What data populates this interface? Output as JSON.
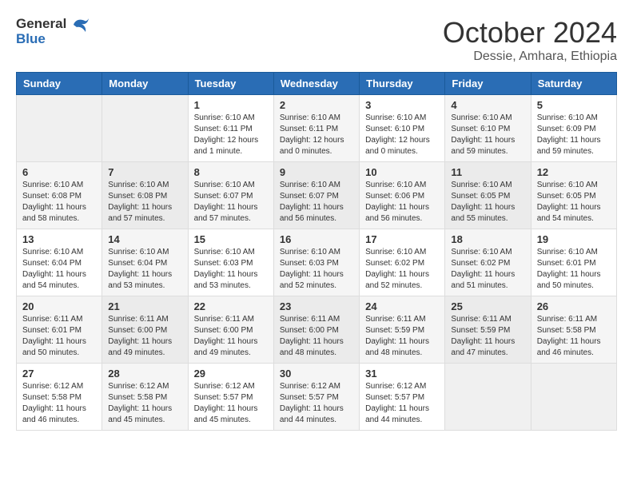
{
  "header": {
    "logo_line1": "General",
    "logo_line2": "Blue",
    "month": "October 2024",
    "location": "Dessie, Amhara, Ethiopia"
  },
  "weekdays": [
    "Sunday",
    "Monday",
    "Tuesday",
    "Wednesday",
    "Thursday",
    "Friday",
    "Saturday"
  ],
  "weeks": [
    [
      {
        "day": "",
        "info": ""
      },
      {
        "day": "",
        "info": ""
      },
      {
        "day": "1",
        "info": "Sunrise: 6:10 AM\nSunset: 6:11 PM\nDaylight: 12 hours\nand 1 minute."
      },
      {
        "day": "2",
        "info": "Sunrise: 6:10 AM\nSunset: 6:11 PM\nDaylight: 12 hours\nand 0 minutes."
      },
      {
        "day": "3",
        "info": "Sunrise: 6:10 AM\nSunset: 6:10 PM\nDaylight: 12 hours\nand 0 minutes."
      },
      {
        "day": "4",
        "info": "Sunrise: 6:10 AM\nSunset: 6:10 PM\nDaylight: 11 hours\nand 59 minutes."
      },
      {
        "day": "5",
        "info": "Sunrise: 6:10 AM\nSunset: 6:09 PM\nDaylight: 11 hours\nand 59 minutes."
      }
    ],
    [
      {
        "day": "6",
        "info": "Sunrise: 6:10 AM\nSunset: 6:08 PM\nDaylight: 11 hours\nand 58 minutes."
      },
      {
        "day": "7",
        "info": "Sunrise: 6:10 AM\nSunset: 6:08 PM\nDaylight: 11 hours\nand 57 minutes."
      },
      {
        "day": "8",
        "info": "Sunrise: 6:10 AM\nSunset: 6:07 PM\nDaylight: 11 hours\nand 57 minutes."
      },
      {
        "day": "9",
        "info": "Sunrise: 6:10 AM\nSunset: 6:07 PM\nDaylight: 11 hours\nand 56 minutes."
      },
      {
        "day": "10",
        "info": "Sunrise: 6:10 AM\nSunset: 6:06 PM\nDaylight: 11 hours\nand 56 minutes."
      },
      {
        "day": "11",
        "info": "Sunrise: 6:10 AM\nSunset: 6:05 PM\nDaylight: 11 hours\nand 55 minutes."
      },
      {
        "day": "12",
        "info": "Sunrise: 6:10 AM\nSunset: 6:05 PM\nDaylight: 11 hours\nand 54 minutes."
      }
    ],
    [
      {
        "day": "13",
        "info": "Sunrise: 6:10 AM\nSunset: 6:04 PM\nDaylight: 11 hours\nand 54 minutes."
      },
      {
        "day": "14",
        "info": "Sunrise: 6:10 AM\nSunset: 6:04 PM\nDaylight: 11 hours\nand 53 minutes."
      },
      {
        "day": "15",
        "info": "Sunrise: 6:10 AM\nSunset: 6:03 PM\nDaylight: 11 hours\nand 53 minutes."
      },
      {
        "day": "16",
        "info": "Sunrise: 6:10 AM\nSunset: 6:03 PM\nDaylight: 11 hours\nand 52 minutes."
      },
      {
        "day": "17",
        "info": "Sunrise: 6:10 AM\nSunset: 6:02 PM\nDaylight: 11 hours\nand 52 minutes."
      },
      {
        "day": "18",
        "info": "Sunrise: 6:10 AM\nSunset: 6:02 PM\nDaylight: 11 hours\nand 51 minutes."
      },
      {
        "day": "19",
        "info": "Sunrise: 6:10 AM\nSunset: 6:01 PM\nDaylight: 11 hours\nand 50 minutes."
      }
    ],
    [
      {
        "day": "20",
        "info": "Sunrise: 6:11 AM\nSunset: 6:01 PM\nDaylight: 11 hours\nand 50 minutes."
      },
      {
        "day": "21",
        "info": "Sunrise: 6:11 AM\nSunset: 6:00 PM\nDaylight: 11 hours\nand 49 minutes."
      },
      {
        "day": "22",
        "info": "Sunrise: 6:11 AM\nSunset: 6:00 PM\nDaylight: 11 hours\nand 49 minutes."
      },
      {
        "day": "23",
        "info": "Sunrise: 6:11 AM\nSunset: 6:00 PM\nDaylight: 11 hours\nand 48 minutes."
      },
      {
        "day": "24",
        "info": "Sunrise: 6:11 AM\nSunset: 5:59 PM\nDaylight: 11 hours\nand 48 minutes."
      },
      {
        "day": "25",
        "info": "Sunrise: 6:11 AM\nSunset: 5:59 PM\nDaylight: 11 hours\nand 47 minutes."
      },
      {
        "day": "26",
        "info": "Sunrise: 6:11 AM\nSunset: 5:58 PM\nDaylight: 11 hours\nand 46 minutes."
      }
    ],
    [
      {
        "day": "27",
        "info": "Sunrise: 6:12 AM\nSunset: 5:58 PM\nDaylight: 11 hours\nand 46 minutes."
      },
      {
        "day": "28",
        "info": "Sunrise: 6:12 AM\nSunset: 5:58 PM\nDaylight: 11 hours\nand 45 minutes."
      },
      {
        "day": "29",
        "info": "Sunrise: 6:12 AM\nSunset: 5:57 PM\nDaylight: 11 hours\nand 45 minutes."
      },
      {
        "day": "30",
        "info": "Sunrise: 6:12 AM\nSunset: 5:57 PM\nDaylight: 11 hours\nand 44 minutes."
      },
      {
        "day": "31",
        "info": "Sunrise: 6:12 AM\nSunset: 5:57 PM\nDaylight: 11 hours\nand 44 minutes."
      },
      {
        "day": "",
        "info": ""
      },
      {
        "day": "",
        "info": ""
      }
    ]
  ]
}
